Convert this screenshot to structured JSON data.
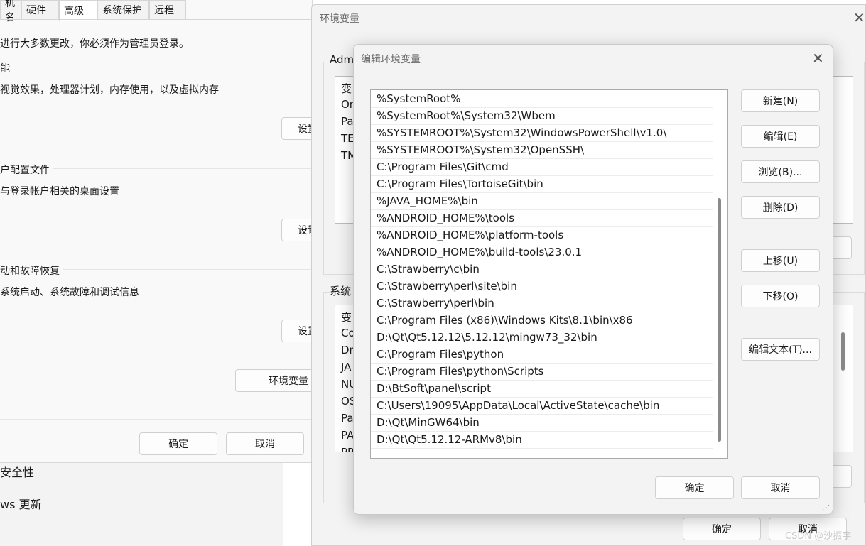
{
  "system_properties": {
    "tabs": [
      "机名",
      "硬件",
      "高级",
      "系统保护",
      "远程"
    ],
    "notice": "进行大多数更改，你必须作为管理员登录。",
    "performance": {
      "title": "能",
      "desc": "视觉效果，处理器计划，内存使用，以及虚拟内存",
      "button": "设置"
    },
    "user_profiles": {
      "title": "户配置文件",
      "desc": "与登录帐户相关的桌面设置",
      "button": "设置"
    },
    "startup_recovery": {
      "title": "动和故障恢复",
      "desc": "系统启动、系统故障和调试信息",
      "button": "设置"
    },
    "env_button": "环境变量",
    "ok": "确定",
    "cancel": "取消"
  },
  "settings_sidebar": {
    "items": [
      "安全性",
      "ws 更新"
    ]
  },
  "env_window": {
    "title": "环境变量",
    "user_section_label": "Adm",
    "user_vars_header": "变",
    "user_vars": [
      "On",
      "Pa",
      "TE",
      "TM"
    ],
    "system_section_label": "系统",
    "system_vars_header": "变",
    "system_vars": [
      "Co",
      "Dr",
      "JA",
      "NU",
      "OS",
      "Pa",
      "PA",
      "PR"
    ],
    "ok": "确定",
    "cancel": "取消"
  },
  "edit_dialog": {
    "title": "编辑环境变量",
    "paths": [
      "%SystemRoot%",
      "%SystemRoot%\\System32\\Wbem",
      "%SYSTEMROOT%\\System32\\WindowsPowerShell\\v1.0\\",
      "%SYSTEMROOT%\\System32\\OpenSSH\\",
      "C:\\Program Files\\Git\\cmd",
      "C:\\Program Files\\TortoiseGit\\bin",
      "%JAVA_HOME%\\bin",
      "%ANDROID_HOME%\\tools",
      "%ANDROID_HOME%\\platform-tools",
      "%ANDROID_HOME%\\build-tools\\23.0.1",
      "C:\\Strawberry\\c\\bin",
      "C:\\Strawberry\\perl\\site\\bin",
      "C:\\Strawberry\\perl\\bin",
      "C:\\Program Files (x86)\\Windows Kits\\8.1\\bin\\x86",
      "D:\\Qt\\Qt5.12.12\\5.12.12\\mingw73_32\\bin",
      "C:\\Program Files\\python",
      "C:\\Program Files\\python\\Scripts",
      "D:\\BtSoft\\panel\\script",
      "C:\\Users\\19095\\AppData\\Local\\ActiveState\\cache\\bin",
      "D:\\Qt\\MinGW64\\bin",
      "D:\\Qt\\Qt5.12.12-ARMv8\\bin"
    ],
    "buttons": {
      "new": "新建(N)",
      "edit": "编辑(E)",
      "browse": "浏览(B)...",
      "delete": "删除(D)",
      "move_up": "上移(U)",
      "move_down": "下移(O)",
      "edit_text": "编辑文本(T)..."
    },
    "ok": "确定",
    "cancel": "取消"
  },
  "watermark": "CSDN @沙振宇"
}
